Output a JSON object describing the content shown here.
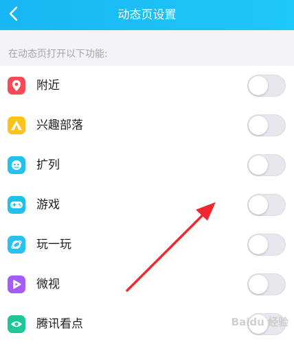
{
  "header": {
    "title": "动态页设置"
  },
  "section": {
    "label": "在动态页打开以下功能:"
  },
  "items": [
    {
      "label": "附近",
      "icon": "location-pin-icon",
      "color": "#f54b57",
      "enabled": false
    },
    {
      "label": "兴趣部落",
      "icon": "tribe-tent-icon",
      "color": "#ffc21a",
      "enabled": false
    },
    {
      "label": "扩列",
      "icon": "expand-friends-icon",
      "color": "#22c3e8",
      "enabled": false
    },
    {
      "label": "游戏",
      "icon": "gamepad-icon",
      "color": "#21c0ec",
      "enabled": false
    },
    {
      "label": "玩一玩",
      "icon": "planet-icon",
      "color": "#27c2f0",
      "enabled": false
    },
    {
      "label": "微视",
      "icon": "play-triangle-icon",
      "color": "#a45cf5",
      "enabled": false
    },
    {
      "label": "腾讯看点",
      "icon": "eye-icon",
      "color": "#1ec79a",
      "enabled": false
    }
  ],
  "annotation": {
    "arrow_color": "#f0272c"
  },
  "watermark": {
    "text": "Baidu 经验"
  }
}
